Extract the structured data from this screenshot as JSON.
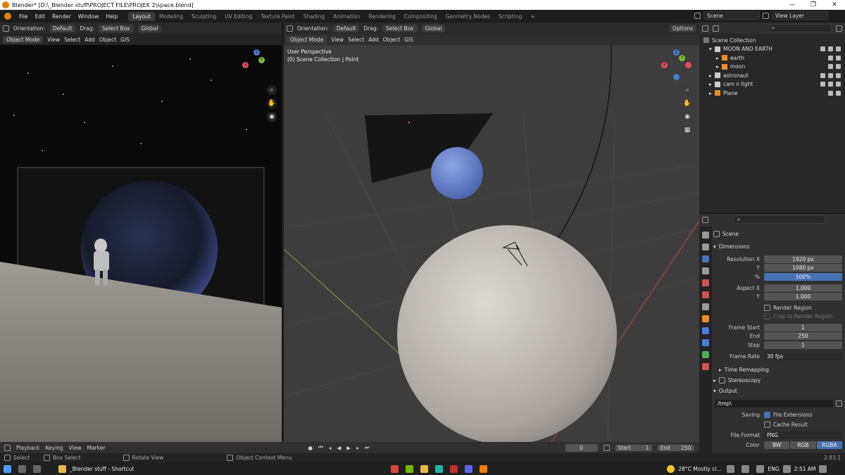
{
  "window": {
    "title": "Blender* [D:\\_Blender stuff\\PROJECT FILE\\PROJEK 2\\space.blend]",
    "minimize": "—",
    "maximize": "❐",
    "close": "✕"
  },
  "menu": {
    "items": [
      "File",
      "Edit",
      "Render",
      "Window",
      "Help"
    ]
  },
  "workspaces": {
    "tabs": [
      "Layout",
      "Modeling",
      "Sculpting",
      "UV Editing",
      "Texture Paint",
      "Shading",
      "Animation",
      "Rendering",
      "Compositing",
      "Geometry Nodes",
      "Scripting"
    ],
    "active": "Layout",
    "add": "+"
  },
  "topright": {
    "scene": "Scene",
    "view_layer": "View Layer"
  },
  "tool_header": {
    "orientation_label": "Orientation:",
    "orientation_value": "Default",
    "drag_label": "Drag:",
    "drag_value": "Select Box",
    "transform": "Global",
    "options": "Options"
  },
  "left_viewport": {
    "mode": "Object Mode",
    "menus": [
      "View",
      "Select",
      "Add",
      "Object",
      "GIS"
    ]
  },
  "main_viewport": {
    "mode": "Object Mode",
    "menus": [
      "View",
      "Select",
      "Add",
      "Object",
      "GIS"
    ],
    "view_name": "User Perspective",
    "collection": "(0) Scene Collection | Point"
  },
  "gizmo": {
    "x": "X",
    "y": "Y",
    "z": "Z"
  },
  "outliner": {
    "root": "Scene Collection",
    "items": [
      {
        "label": "MOON AND EARTH",
        "arrow": "▾"
      },
      {
        "label": "earth",
        "arrow": "▸"
      },
      {
        "label": "moon",
        "arrow": "▸"
      },
      {
        "label": "astronaut",
        "arrow": "▸"
      },
      {
        "label": "cam n light",
        "arrow": "▸"
      },
      {
        "label": "Plane",
        "arrow": "▸"
      }
    ]
  },
  "properties": {
    "scene": "Scene",
    "dimensions": "Dimensions",
    "res_x_label": "Resolution X",
    "res_x": "1920 px",
    "res_y_label": "Y",
    "res_y": "1080 px",
    "res_pct_label": "%",
    "res_pct": "100%",
    "aspect_x_label": "Aspect X",
    "aspect_x": "1.000",
    "aspect_y_label": "Y",
    "aspect_y": "1.000",
    "render_region": "Render Region",
    "crop": "Crop to Render Region",
    "frame_start_label": "Frame Start",
    "frame_start": "1",
    "end_label": "End",
    "end": "250",
    "step_label": "Step",
    "step": "1",
    "frame_rate_label": "Frame Rate",
    "frame_rate": "30 fps",
    "time_remap": "Time Remapping",
    "stereoscopy": "Stereoscopy",
    "output": "Output",
    "path": "/tmp\\",
    "saving_label": "Saving",
    "file_ext": "File Extensions",
    "cache": "Cache Result",
    "format_label": "File Format",
    "format": "PNG",
    "color_label": "Color",
    "color_opts": [
      "BW",
      "RGB",
      "RGBA"
    ],
    "color_active": "RGBA"
  },
  "timeline": {
    "menus": [
      "Playback",
      "Keying",
      "View",
      "Marker"
    ],
    "frame": "0",
    "start_label": "Start",
    "start": "1",
    "end_label": "End",
    "end": "250"
  },
  "status": {
    "select": "Select",
    "box_select": "Box Select",
    "rotate": "Rotate View",
    "context": "Object Context Menu",
    "version": "2.93.1"
  },
  "taskbar": {
    "app": "_Blender stuff - Shortcut",
    "weather": "28°C  Mostly cl...",
    "lang": "ENG",
    "time": "2:51 AM"
  },
  "colors": {
    "accent": "#4772b3",
    "brand": "#e87d0d",
    "bg": "#303030"
  }
}
